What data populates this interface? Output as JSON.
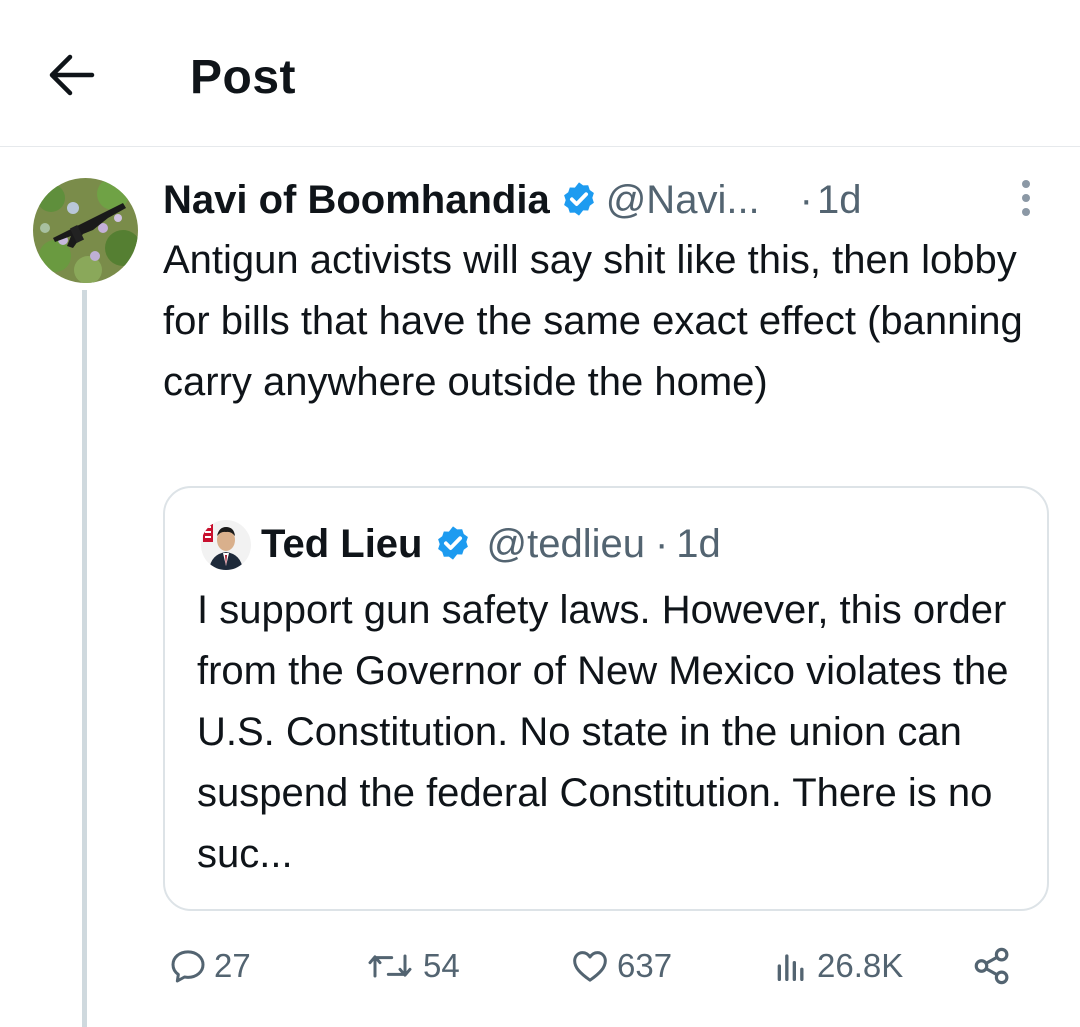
{
  "header": {
    "title": "Post",
    "back_icon": "arrow-left-icon"
  },
  "post": {
    "author_name": "Navi of Boomhandia",
    "handle": "@Navi...",
    "separator": "·",
    "time": "1d",
    "verified_color": "#1d9bf0",
    "text": "Antigun activists will say shit like this, then lobby for bills that have the same exact effect (banning carry anywhere outside the home)"
  },
  "quote": {
    "author_name": "Ted Lieu",
    "handle": "@tedlieu",
    "separator": "·",
    "time": "1d",
    "text": "I support gun safety laws. However, this order from the Governor of New Mexico violates the U.S. Constitution. No state in the union can suspend the federal Constitution. There is no suc..."
  },
  "actions": {
    "replies": "27",
    "reposts": "54",
    "likes": "637",
    "views": "26.8K"
  },
  "colors": {
    "text_primary": "#0f1419",
    "text_secondary": "#536471",
    "border": "#dde3e7",
    "accent": "#1d9bf0"
  }
}
